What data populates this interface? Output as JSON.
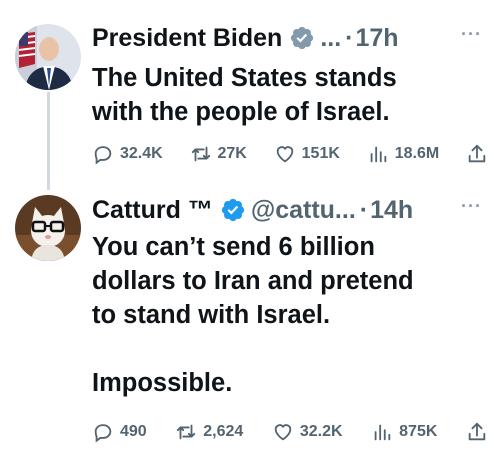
{
  "tweets": [
    {
      "name": "President Biden",
      "handle": "...",
      "dot": "·",
      "time": "17h",
      "more": "···",
      "text": "The United States stands\nwith the people of Israel.",
      "replies": "32.4K",
      "reposts": "27K",
      "likes": "151K",
      "views": "18.6M"
    },
    {
      "name": "Catturd ™",
      "handle": "@cattu...",
      "dot": "·",
      "time": "14h",
      "more": "···",
      "text": "You can’t send 6 billion\ndollars to Iran and pretend\nto stand with Israel.\n\nImpossible.",
      "replies": "490",
      "reposts": "2,624",
      "likes": "32.2K",
      "views": "875K"
    }
  ],
  "colors": {
    "verified": "#1d9bf0",
    "muted": "#536471",
    "thread_line": "#cfd9de"
  },
  "icons": [
    "verified-badge-icon",
    "reply-icon",
    "repost-icon",
    "like-icon",
    "views-icon",
    "share-icon"
  ]
}
